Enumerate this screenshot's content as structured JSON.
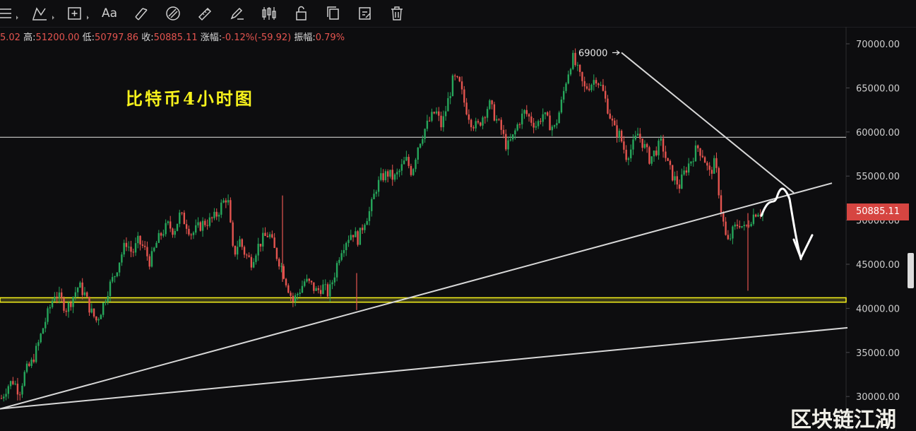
{
  "toolbar": {
    "font_label": "Aa",
    "tools": [
      "menu-icon",
      "path-icon",
      "crosshair-add-icon",
      "text-tool",
      "fib-icon",
      "fib-channel-icon",
      "ruler-icon",
      "pen-icon",
      "candles-icon",
      "lock-icon",
      "copy-icon",
      "edit-note-icon",
      "trash-icon"
    ]
  },
  "ohlc": {
    "open_tail": "5.02",
    "high_label": "高:",
    "high": "51200.00",
    "low_label": "低:",
    "low": "50797.86",
    "close_label": "收:",
    "close": "50885.11",
    "change_label": "涨幅:",
    "change": "-0.12%(-59.92)",
    "amplitude_label": "振幅:",
    "amplitude": "0.79%"
  },
  "chart_data": {
    "type": "candlestick",
    "title": "比特币4小时图",
    "ylim": [
      27000,
      73000
    ],
    "yticks": [
      "70000.00",
      "65000.00",
      "60000.00",
      "55000.00",
      "50000.00",
      "45000.00",
      "40000.00",
      "35000.00",
      "30000.00"
    ],
    "ytick_values": [
      70000,
      65000,
      60000,
      55000,
      50000,
      45000,
      40000,
      35000,
      30000
    ],
    "last_price": "50885.11",
    "peak_annotation": "69000",
    "horizontal_levels": [
      59400
    ],
    "support_zone": [
      40700,
      41200
    ],
    "colors": {
      "up": "#26a65b",
      "down": "#e4544f",
      "text": "#cfcfcf",
      "trend": "#d8d8d8",
      "support": "#f7f21c",
      "badge": "#d64541"
    },
    "close_path": [
      29800,
      31200,
      31800,
      30500,
      32800,
      33700,
      35500,
      37800,
      39800,
      41800,
      40900,
      39900,
      41300,
      42600,
      41600,
      39700,
      38600,
      40200,
      42300,
      43700,
      45800,
      47500,
      46200,
      47600,
      46800,
      45200,
      47300,
      48600,
      49400,
      48800,
      50600,
      49700,
      48400,
      49100,
      49700,
      49900,
      50400,
      51700,
      52800,
      45900,
      47800,
      46100,
      45300,
      46900,
      47900,
      48500,
      46400,
      44900,
      42800,
      40800,
      41900,
      43100,
      42700,
      41900,
      42500,
      41600,
      43900,
      46600,
      47800,
      48700,
      47800,
      49900,
      51100,
      53700,
      54900,
      55300,
      54700,
      55600,
      56900,
      55400,
      58400,
      60100,
      61300,
      62400,
      60600,
      63300,
      66100,
      65400,
      62900,
      61200,
      60500,
      61900,
      63200,
      61700,
      60300,
      58200,
      59400,
      61200,
      62300,
      61400,
      60700,
      62100,
      61000,
      60400,
      62800,
      66100,
      68500,
      66700,
      64900,
      65400,
      66200,
      64800,
      62600,
      60300,
      59600,
      57300,
      58200,
      59800,
      58500,
      56900,
      57900,
      58800,
      56300,
      54800,
      53900,
      55700,
      56900,
      58300,
      57400,
      55200,
      56600,
      51200,
      47200,
      48800,
      49800,
      48900,
      50200,
      51100,
      50900
    ]
  }
}
